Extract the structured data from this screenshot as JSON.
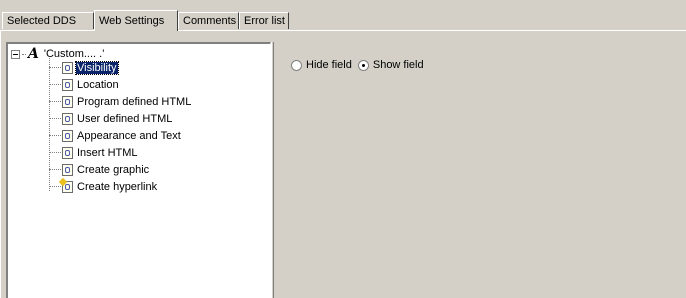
{
  "tabs": [
    {
      "label": "Selected DDS",
      "active": false
    },
    {
      "label": "Web Settings",
      "active": true
    },
    {
      "label": "Comments",
      "active": false
    },
    {
      "label": "Error list",
      "active": false
    }
  ],
  "tree": {
    "root": {
      "label": "'Custom.... .'",
      "icon": "text-a-icon",
      "expanded": true
    },
    "items": [
      {
        "label": "Visibility",
        "icon": "web-setting-icon",
        "selected": true
      },
      {
        "label": "Location",
        "icon": "web-setting-icon",
        "selected": false
      },
      {
        "label": "Program defined HTML",
        "icon": "web-setting-icon",
        "selected": false
      },
      {
        "label": "User defined HTML",
        "icon": "web-setting-icon",
        "selected": false
      },
      {
        "label": "Appearance and Text",
        "icon": "web-setting-icon",
        "selected": false
      },
      {
        "label": "Insert HTML",
        "icon": "web-setting-icon",
        "selected": false
      },
      {
        "label": "Create graphic",
        "icon": "web-setting-icon",
        "selected": false
      },
      {
        "label": "Create hyperlink",
        "icon": "hyperlink-icon",
        "selected": false
      }
    ]
  },
  "visibility": {
    "options": [
      {
        "label": "Hide field",
        "checked": false
      },
      {
        "label": "Show field",
        "checked": true
      }
    ]
  },
  "colors": {
    "window_background": "#d4d0c8",
    "selection": "#0a246a",
    "tree_background": "#ffffff"
  }
}
